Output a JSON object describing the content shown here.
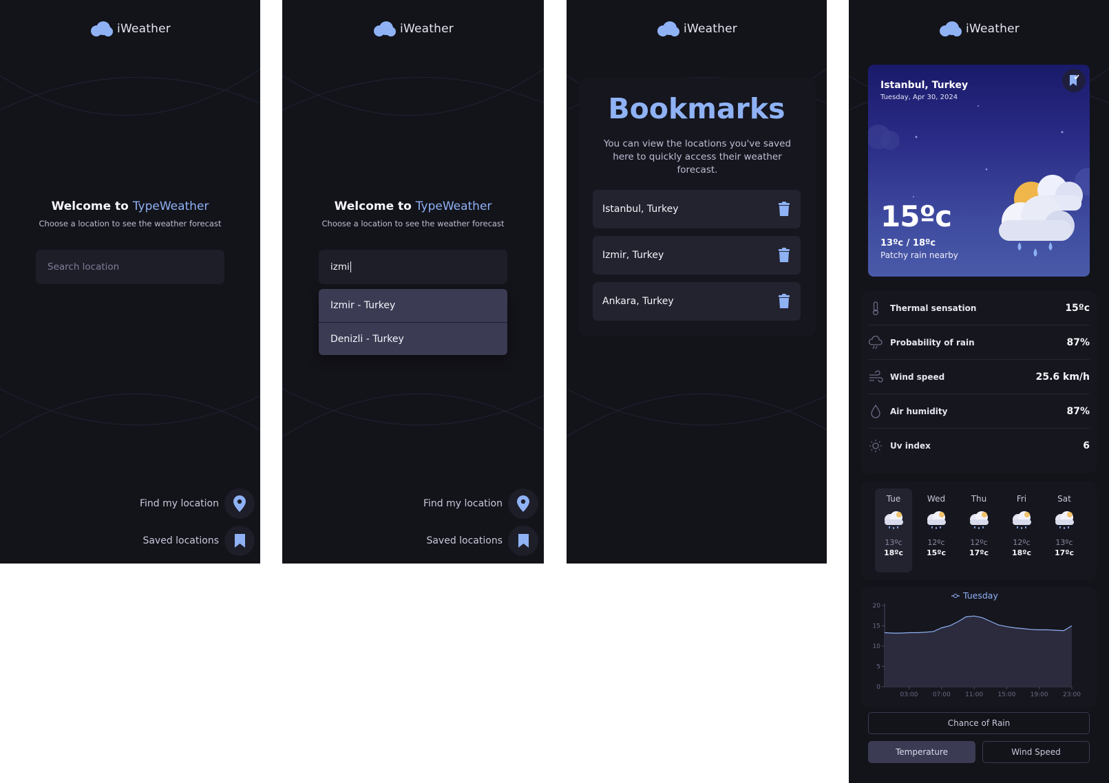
{
  "app": {
    "name": "iWeather"
  },
  "welcome": {
    "prefix": "Welcome to ",
    "brand": "TypeWeather",
    "subtitle": "Choose a location to see the weather forecast"
  },
  "search": {
    "placeholder": "Search location",
    "value": "izmi"
  },
  "suggestions": [
    "Izmir - Turkey",
    "Denizli - Turkey"
  ],
  "actions": {
    "find_location": "Find my location",
    "saved_locations": "Saved locations"
  },
  "bookmarks": {
    "title": "Bookmarks",
    "description": "You can view the locations you've saved here to quickly access their weather forecast.",
    "items": [
      "Istanbul, Turkey",
      "Izmir, Turkey",
      "Ankara, Turkey"
    ]
  },
  "current": {
    "city": "Istanbul, Turkey",
    "date": "Tuesday, Apr 30, 2024",
    "temp": "15ºc",
    "range": "13ºc / 18ºc",
    "description": "Patchy rain nearby"
  },
  "details": [
    {
      "label": "Thermal sensation",
      "value": "15ºc",
      "icon": "thermometer-icon"
    },
    {
      "label": "Probability of rain",
      "value": "87%",
      "icon": "cloud-rain-icon"
    },
    {
      "label": "Wind speed",
      "value": "25.6 km/h",
      "icon": "wind-icon"
    },
    {
      "label": "Air humidity",
      "value": "87%",
      "icon": "drop-icon"
    },
    {
      "label": "Uv index",
      "value": "6",
      "icon": "sun-icon"
    }
  ],
  "forecast": [
    {
      "day": "Tue",
      "min": "13ºc",
      "max": "18ºc"
    },
    {
      "day": "Wed",
      "min": "12ºc",
      "max": "15ºc"
    },
    {
      "day": "Thu",
      "min": "12ºc",
      "max": "17ºc"
    },
    {
      "day": "Fri",
      "min": "12ºc",
      "max": "18ºc"
    },
    {
      "day": "Sat",
      "min": "13ºc",
      "max": "17ºc"
    }
  ],
  "chart_tabs": {
    "rain": "Chance of Rain",
    "temperature": "Temperature",
    "wind": "Wind Speed"
  },
  "chart_data": {
    "type": "area",
    "legend": "Tuesday",
    "x": [
      "00:00",
      "01:00",
      "02:00",
      "03:00",
      "04:00",
      "05:00",
      "06:00",
      "07:00",
      "08:00",
      "09:00",
      "10:00",
      "11:00",
      "12:00",
      "13:00",
      "14:00",
      "15:00",
      "16:00",
      "17:00",
      "18:00",
      "19:00",
      "20:00",
      "21:00",
      "22:00",
      "23:00"
    ],
    "xticks": [
      "03:00",
      "07:00",
      "11:00",
      "15:00",
      "19:00",
      "23:00"
    ],
    "yticks": [
      "0",
      "5",
      "10",
      "15",
      "20"
    ],
    "values": [
      13.3,
      13.2,
      13.2,
      13.3,
      13.3,
      13.4,
      13.6,
      14.5,
      15.0,
      16.0,
      17.2,
      17.4,
      17.0,
      16.1,
      15.2,
      14.8,
      14.5,
      14.3,
      14.1,
      14.0,
      14.0,
      13.9,
      13.8,
      15.0
    ],
    "ylim": [
      0,
      20
    ],
    "series_color": "#8fb2f5"
  }
}
